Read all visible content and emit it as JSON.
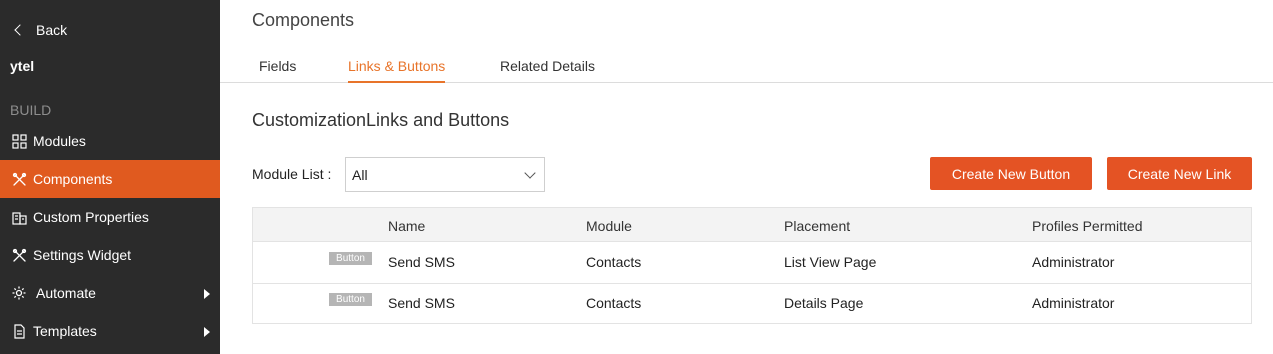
{
  "sidebar": {
    "back_label": "Back",
    "org_name": "ytel",
    "section_label": "BUILD",
    "items": [
      {
        "label": "Modules",
        "icon": "modules-icon"
      },
      {
        "label": "Components",
        "icon": "tools-icon",
        "active": true
      },
      {
        "label": "Custom Properties",
        "icon": "building-icon"
      },
      {
        "label": "Settings Widget",
        "icon": "tools-icon"
      },
      {
        "label": "Automate",
        "icon": "gear-icon",
        "has_submenu": true
      },
      {
        "label": "Templates",
        "icon": "document-icon",
        "has_submenu": true
      }
    ]
  },
  "header": {
    "title": "Components",
    "tabs": [
      {
        "label": "Fields"
      },
      {
        "label": "Links & Buttons",
        "active": true
      },
      {
        "label": "Related Details"
      }
    ]
  },
  "content": {
    "section_title": "CustomizationLinks and Buttons",
    "module_list_label": "Module List :",
    "module_list_value": "All",
    "create_button_label": "Create New Button",
    "create_link_label": "Create New Link"
  },
  "table": {
    "columns": [
      "Name",
      "Module",
      "Placement",
      "Profiles Permitted"
    ],
    "rows": [
      {
        "type_badge": "Button",
        "name": "Send SMS",
        "module": "Contacts",
        "placement": "List View Page",
        "profiles": "Administrator"
      },
      {
        "type_badge": "Button",
        "name": "Send SMS",
        "module": "Contacts",
        "placement": "Details Page",
        "profiles": "Administrator"
      }
    ]
  },
  "colors": {
    "sidebar_bg": "#2b2b2b",
    "active_nav": "#e05a1f",
    "accent": "#e8742a",
    "button": "#e45324"
  }
}
